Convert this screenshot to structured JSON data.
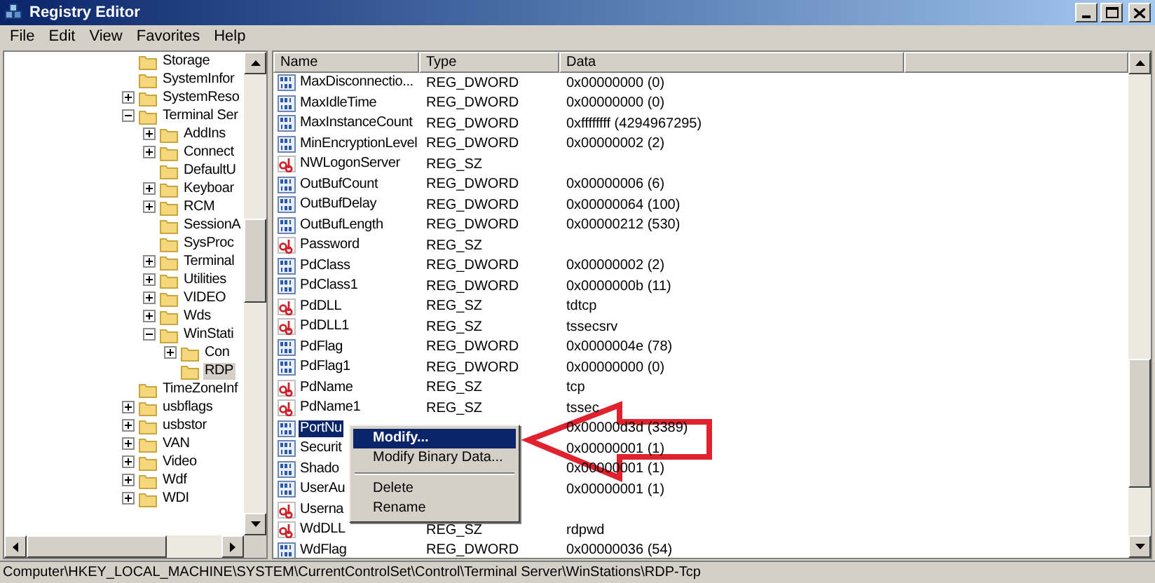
{
  "window": {
    "title": "Registry Editor"
  },
  "menu": [
    "File",
    "Edit",
    "View",
    "Favorites",
    "Help"
  ],
  "tree": [
    {
      "label": "Storage",
      "selected": false
    },
    {
      "label": "SystemInfor",
      "selected": false
    },
    {
      "label": "SystemReso",
      "expanded": false,
      "selected": false
    },
    {
      "label": "Terminal Ser",
      "expanded": true,
      "selected": false,
      "children": [
        {
          "label": "AddIns",
          "expanded": false,
          "selected": false
        },
        {
          "label": "Connect",
          "expanded": false,
          "selected": false
        },
        {
          "label": "DefaultU",
          "selected": false
        },
        {
          "label": "Keyboar",
          "expanded": false,
          "selected": false
        },
        {
          "label": "RCM",
          "expanded": false,
          "selected": false
        },
        {
          "label": "SessionA",
          "selected": false
        },
        {
          "label": "SysProc",
          "selected": false
        },
        {
          "label": "Terminal",
          "expanded": false,
          "selected": false
        },
        {
          "label": "Utilities",
          "expanded": false,
          "selected": false
        },
        {
          "label": "VIDEO",
          "expanded": false,
          "selected": false
        },
        {
          "label": "Wds",
          "expanded": false,
          "selected": false
        },
        {
          "label": "WinStati",
          "expanded": true,
          "selected": false,
          "children": [
            {
              "label": "Con",
              "expanded": false,
              "selected": false
            },
            {
              "label": "RDP",
              "selected": true
            }
          ]
        }
      ]
    },
    {
      "label": "TimeZoneInf",
      "selected": false
    },
    {
      "label": "usbflags",
      "expanded": false,
      "selected": false
    },
    {
      "label": "usbstor",
      "expanded": false,
      "selected": false
    },
    {
      "label": "VAN",
      "expanded": false,
      "selected": false
    },
    {
      "label": "Video",
      "expanded": false,
      "selected": false
    },
    {
      "label": "Wdf",
      "expanded": false,
      "selected": false
    },
    {
      "label": "WDI",
      "expanded": false,
      "selected": false
    }
  ],
  "table": {
    "columns": [
      "Name",
      "Type",
      "Data"
    ],
    "rows": [
      {
        "kind": "binary",
        "name": "MaxDisconnectio...",
        "type": "REG_DWORD",
        "data": "0x00000000 (0)",
        "selected": false
      },
      {
        "kind": "binary",
        "name": "MaxIdleTime",
        "type": "REG_DWORD",
        "data": "0x00000000 (0)",
        "selected": false
      },
      {
        "kind": "binary",
        "name": "MaxInstanceCount",
        "type": "REG_DWORD",
        "data": "0xffffffff (4294967295)",
        "selected": false
      },
      {
        "kind": "binary",
        "name": "MinEncryptionLevel",
        "type": "REG_DWORD",
        "data": "0x00000002 (2)",
        "selected": false
      },
      {
        "kind": "string",
        "name": "NWLogonServer",
        "type": "REG_SZ",
        "selected": false
      },
      {
        "kind": "binary",
        "name": "OutBufCount",
        "type": "REG_DWORD",
        "data": "0x00000006 (6)",
        "selected": false
      },
      {
        "kind": "binary",
        "name": "OutBufDelay",
        "type": "REG_DWORD",
        "data": "0x00000064 (100)",
        "selected": false
      },
      {
        "kind": "binary",
        "name": "OutBufLength",
        "type": "REG_DWORD",
        "data": "0x00000212 (530)",
        "selected": false
      },
      {
        "kind": "string",
        "name": "Password",
        "type": "REG_SZ",
        "selected": false
      },
      {
        "kind": "binary",
        "name": "PdClass",
        "type": "REG_DWORD",
        "data": "0x00000002 (2)",
        "selected": false
      },
      {
        "kind": "binary",
        "name": "PdClass1",
        "type": "REG_DWORD",
        "data": "0x0000000b (11)",
        "selected": false
      },
      {
        "kind": "string",
        "name": "PdDLL",
        "type": "REG_SZ",
        "data": "tdtcp",
        "selected": false
      },
      {
        "kind": "string",
        "name": "PdDLL1",
        "type": "REG_SZ",
        "data": "tssecsrv",
        "selected": false
      },
      {
        "kind": "binary",
        "name": "PdFlag",
        "type": "REG_DWORD",
        "data": "0x0000004e (78)",
        "selected": false
      },
      {
        "kind": "binary",
        "name": "PdFlag1",
        "type": "REG_DWORD",
        "data": "0x00000000 (0)",
        "selected": false
      },
      {
        "kind": "string",
        "name": "PdName",
        "type": "REG_SZ",
        "data": "tcp",
        "selected": false
      },
      {
        "kind": "string",
        "name": "PdName1",
        "type": "REG_SZ",
        "data": "tssec",
        "selected": false
      },
      {
        "kind": "binary",
        "name": "PortNu",
        "data": "0x00000d3d (3389)",
        "selected": true
      },
      {
        "kind": "binary",
        "name": "Securit",
        "data": "0x00000001 (1)",
        "selected": false
      },
      {
        "kind": "binary",
        "name": "Shado",
        "data": "0x00000001 (1)",
        "selected": false
      },
      {
        "kind": "binary",
        "name": "UserAu",
        "data": "0x00000001 (1)",
        "selected": false
      },
      {
        "kind": "string",
        "name": "Userna",
        "selected": false
      },
      {
        "kind": "string",
        "name": "WdDLL",
        "type": "REG_SZ",
        "data": "rdpwd",
        "selected": false
      },
      {
        "kind": "binary",
        "name": "WdFlag",
        "type": "REG_DWORD",
        "data": "0x00000036 (54)",
        "selected": false
      }
    ]
  },
  "context_menu": [
    {
      "kind": "item",
      "label": "Modify...",
      "selected": true
    },
    {
      "kind": "item",
      "label": "Modify Binary Data...",
      "selected": false
    },
    {
      "kind": "separator"
    },
    {
      "kind": "item",
      "label": "Delete",
      "selected": false
    },
    {
      "kind": "item",
      "label": "Rename",
      "selected": false
    }
  ],
  "status_bar": "Computer\\HKEY_LOCAL_MACHINE\\SYSTEM\\CurrentControlSet\\Control\\Terminal Server\\WinStations\\RDP-Tcp"
}
